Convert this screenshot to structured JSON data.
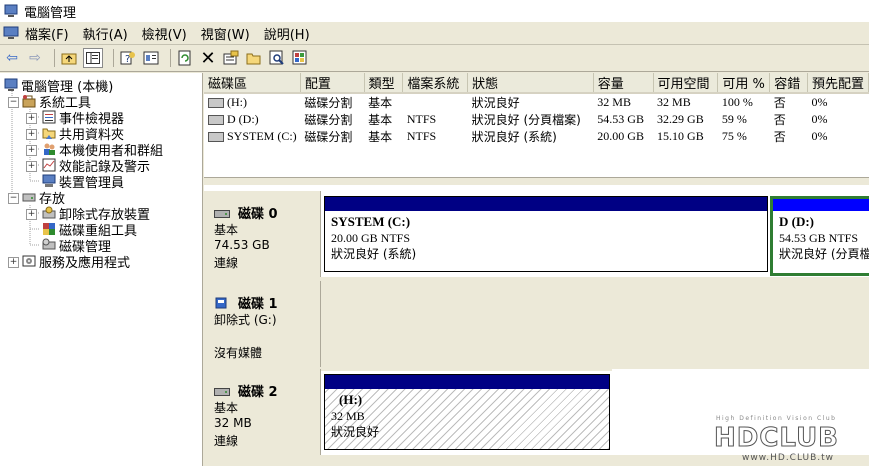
{
  "window": {
    "title": "電腦管理"
  },
  "menu": [
    "檔案(F)",
    "執行(A)",
    "檢視(V)",
    "視窗(W)",
    "說明(H)"
  ],
  "toolbar": [
    "back-icon",
    "forward-icon",
    "up-folder-icon",
    "show-tree-icon",
    "help-icon",
    "properties-icon",
    "refresh-icon",
    "delete-icon",
    "properties-sheet-icon",
    "open-icon",
    "search-icon",
    "export-icon"
  ],
  "tree": [
    {
      "label": "電腦管理 (本機)",
      "level": 0
    },
    {
      "label": "系統工具",
      "level": 1
    },
    {
      "label": "事件檢視器",
      "level": 2
    },
    {
      "label": "共用資料夾",
      "level": 2
    },
    {
      "label": "本機使用者和群組",
      "level": 2
    },
    {
      "label": "效能記錄及警示",
      "level": 2
    },
    {
      "label": "裝置管理員",
      "level": 2
    },
    {
      "label": "存放",
      "level": 1
    },
    {
      "label": "卸除式存放裝置",
      "level": 2
    },
    {
      "label": "磁碟重組工具",
      "level": 2
    },
    {
      "label": "磁碟管理",
      "level": 2
    },
    {
      "label": "服務及應用程式",
      "level": 1
    }
  ],
  "volumes": {
    "columns": [
      "磁碟區",
      "配置",
      "類型",
      "檔案系統",
      "狀態",
      "容量",
      "可用空間",
      "可用 %",
      "容錯",
      "預先配置"
    ],
    "rows": [
      [
        "(H:)",
        "磁碟分割",
        "基本",
        "",
        "狀況良好",
        "32 MB",
        "32 MB",
        "100 %",
        "否",
        "0%"
      ],
      [
        "D (D:)",
        "磁碟分割",
        "基本",
        "NTFS",
        "狀況良好 (分頁檔案)",
        "54.53 GB",
        "32.29 GB",
        "59 %",
        "否",
        "0%"
      ],
      [
        "SYSTEM (C:)",
        "磁碟分割",
        "基本",
        "NTFS",
        "狀況良好 (系統)",
        "20.00 GB",
        "15.10 GB",
        "75 %",
        "否",
        "0%"
      ]
    ]
  },
  "disks": [
    {
      "name": "磁碟 0",
      "type": "基本",
      "size": "74.53 GB",
      "status": "連線",
      "partitions": [
        {
          "title": "SYSTEM  (C:)",
          "size": "20.00 GB NTFS",
          "status": "狀況良好 (系統)"
        },
        {
          "title": "D  (D:)",
          "size": "54.53 GB NTFS",
          "status": "狀況良好 (分頁檔"
        }
      ]
    },
    {
      "name": "磁碟 1",
      "type": "卸除式 (G:)",
      "size": "",
      "status": "沒有媒體",
      "partitions": []
    },
    {
      "name": "磁碟 2",
      "type": "基本",
      "size": "32 MB",
      "status": "連線",
      "partitions": [
        {
          "title": "(H:)",
          "size": "32 MB",
          "status": "狀況良好"
        }
      ]
    }
  ],
  "watermark": {
    "brand": "HDCLUB",
    "tagline": "High Definition Vision Club",
    "url": "www.HD.CLUB.tw"
  },
  "colors": {
    "partition_bar": "#000084",
    "selected_border": "#2f7d32",
    "panel_bg": "#ece9d8"
  }
}
